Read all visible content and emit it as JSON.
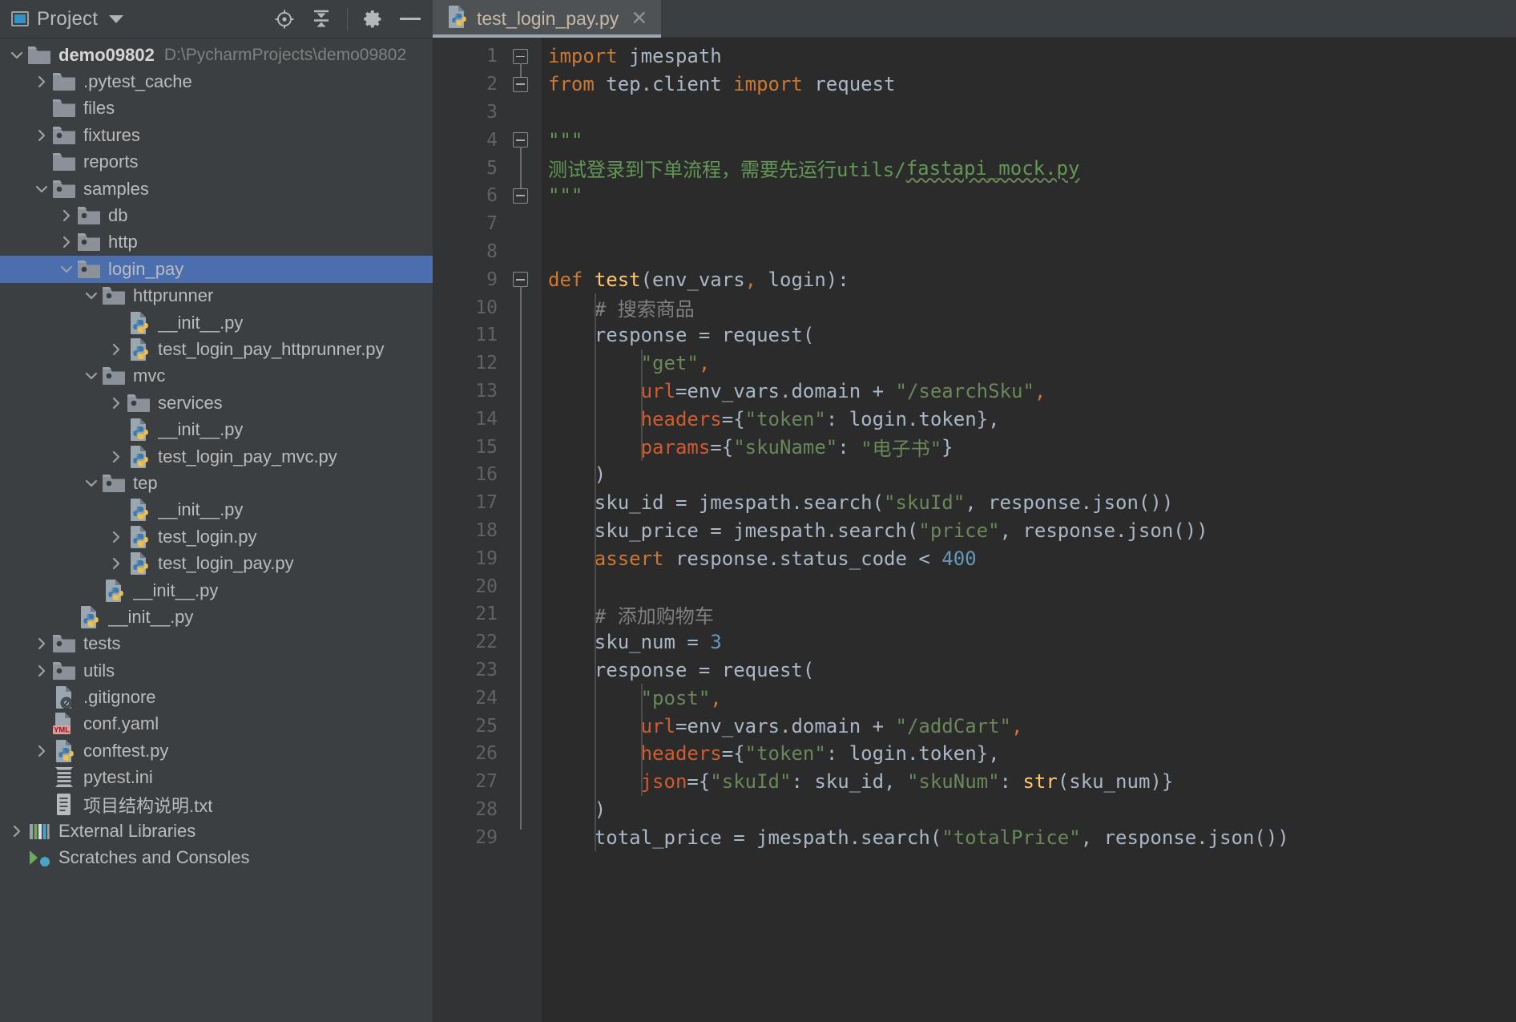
{
  "toolwindow": {
    "title": "Project",
    "dropdown_icon": "chevron-down-icon",
    "window_icon": "project-window-icon",
    "actions": [
      {
        "name": "locate-icon",
        "title": "Select Opened File"
      },
      {
        "name": "collapse-all-icon",
        "title": "Collapse All"
      },
      {
        "name": "gear-icon",
        "title": "Settings"
      },
      {
        "name": "minimize-icon",
        "title": "Hide"
      }
    ]
  },
  "tree": [
    {
      "label": "demo09802",
      "path": "D:\\PycharmProjects\\demo09802",
      "icon": "folder-icon",
      "arrow": "down",
      "indent": 0,
      "bold": true,
      "selected": false
    },
    {
      "label": ".pytest_cache",
      "path": "",
      "icon": "folder-icon",
      "arrow": "right",
      "indent": 1,
      "bold": false,
      "selected": false
    },
    {
      "label": "files",
      "path": "",
      "icon": "folder-icon",
      "arrow": "none",
      "indent": 1,
      "bold": false,
      "selected": false
    },
    {
      "label": "fixtures",
      "path": "",
      "icon": "source-folder-icon",
      "arrow": "right",
      "indent": 1,
      "bold": false,
      "selected": false
    },
    {
      "label": "reports",
      "path": "",
      "icon": "folder-icon",
      "arrow": "none",
      "indent": 1,
      "bold": false,
      "selected": false
    },
    {
      "label": "samples",
      "path": "",
      "icon": "source-folder-icon",
      "arrow": "down",
      "indent": 1,
      "bold": false,
      "selected": false
    },
    {
      "label": "db",
      "path": "",
      "icon": "source-folder-icon",
      "arrow": "right",
      "indent": 2,
      "bold": false,
      "selected": false
    },
    {
      "label": "http",
      "path": "",
      "icon": "source-folder-icon",
      "arrow": "right",
      "indent": 2,
      "bold": false,
      "selected": false
    },
    {
      "label": "login_pay",
      "path": "",
      "icon": "source-folder-icon",
      "arrow": "down",
      "indent": 2,
      "bold": false,
      "selected": true
    },
    {
      "label": "httprunner",
      "path": "",
      "icon": "source-folder-icon",
      "arrow": "down",
      "indent": 3,
      "bold": false,
      "selected": false
    },
    {
      "label": "__init__.py",
      "path": "",
      "icon": "python-file-icon",
      "arrow": "none",
      "indent": 4,
      "bold": false,
      "selected": false
    },
    {
      "label": "test_login_pay_httprunner.py",
      "path": "",
      "icon": "python-file-icon",
      "arrow": "right",
      "indent": 4,
      "bold": false,
      "selected": false
    },
    {
      "label": "mvc",
      "path": "",
      "icon": "source-folder-icon",
      "arrow": "down",
      "indent": 3,
      "bold": false,
      "selected": false
    },
    {
      "label": "services",
      "path": "",
      "icon": "source-folder-icon",
      "arrow": "right",
      "indent": 4,
      "bold": false,
      "selected": false
    },
    {
      "label": "__init__.py",
      "path": "",
      "icon": "python-file-icon",
      "arrow": "none",
      "indent": 4,
      "bold": false,
      "selected": false
    },
    {
      "label": "test_login_pay_mvc.py",
      "path": "",
      "icon": "python-file-icon",
      "arrow": "right",
      "indent": 4,
      "bold": false,
      "selected": false
    },
    {
      "label": "tep",
      "path": "",
      "icon": "source-folder-icon",
      "arrow": "down",
      "indent": 3,
      "bold": false,
      "selected": false
    },
    {
      "label": "__init__.py",
      "path": "",
      "icon": "python-file-icon",
      "arrow": "none",
      "indent": 4,
      "bold": false,
      "selected": false
    },
    {
      "label": "test_login.py",
      "path": "",
      "icon": "python-file-icon",
      "arrow": "right",
      "indent": 4,
      "bold": false,
      "selected": false
    },
    {
      "label": "test_login_pay.py",
      "path": "",
      "icon": "python-file-icon",
      "arrow": "right",
      "indent": 4,
      "bold": false,
      "selected": false
    },
    {
      "label": "__init__.py",
      "path": "",
      "icon": "python-file-icon",
      "arrow": "none",
      "indent": 3,
      "bold": false,
      "selected": false
    },
    {
      "label": "__init__.py",
      "path": "",
      "icon": "python-file-icon",
      "arrow": "none",
      "indent": 2,
      "bold": false,
      "selected": false
    },
    {
      "label": "tests",
      "path": "",
      "icon": "source-folder-icon",
      "arrow": "right",
      "indent": 1,
      "bold": false,
      "selected": false
    },
    {
      "label": "utils",
      "path": "",
      "icon": "source-folder-icon",
      "arrow": "right",
      "indent": 1,
      "bold": false,
      "selected": false
    },
    {
      "label": ".gitignore",
      "path": "",
      "icon": "gitignore-file-icon",
      "arrow": "none",
      "indent": 1,
      "bold": false,
      "selected": false
    },
    {
      "label": "conf.yaml",
      "path": "",
      "icon": "yaml-file-icon",
      "arrow": "none",
      "indent": 1,
      "bold": false,
      "selected": false
    },
    {
      "label": "conftest.py",
      "path": "",
      "icon": "python-file-icon",
      "arrow": "right",
      "indent": 1,
      "bold": false,
      "selected": false
    },
    {
      "label": "pytest.ini",
      "path": "",
      "icon": "ini-file-icon",
      "arrow": "none",
      "indent": 1,
      "bold": false,
      "selected": false
    },
    {
      "label": "项目结构说明.txt",
      "path": "",
      "icon": "text-file-icon",
      "arrow": "none",
      "indent": 1,
      "bold": false,
      "selected": false
    },
    {
      "label": "External Libraries",
      "path": "",
      "icon": "libraries-icon",
      "arrow": "right",
      "indent": 0,
      "bold": false,
      "selected": false
    },
    {
      "label": "Scratches and Consoles",
      "path": "",
      "icon": "scratches-icon",
      "arrow": "none",
      "indent": 0,
      "bold": false,
      "selected": false
    }
  ],
  "editor": {
    "tab": {
      "name": "test_login_pay.py",
      "icon": "python-file-icon",
      "close_icon": "close-icon"
    },
    "first_line": 1,
    "lines": [
      {
        "n": 1,
        "fold": "start",
        "run": false,
        "tokens": [
          {
            "t": "import",
            "c": "kw"
          },
          {
            "t": " jmespath",
            "c": "pln"
          }
        ]
      },
      {
        "n": 2,
        "fold": "end",
        "run": false,
        "tokens": [
          {
            "t": "from",
            "c": "kw"
          },
          {
            "t": " tep.client ",
            "c": "pln"
          },
          {
            "t": "import",
            "c": "kw"
          },
          {
            "t": " request",
            "c": "pln"
          }
        ]
      },
      {
        "n": 3,
        "fold": "none",
        "run": false,
        "tokens": []
      },
      {
        "n": 4,
        "fold": "start",
        "run": false,
        "tokens": [
          {
            "t": "\"\"\"",
            "c": "doc"
          }
        ]
      },
      {
        "n": 5,
        "fold": "none",
        "run": false,
        "tokens": [
          {
            "t": "测试登录到下单流程，需要先运行utils/",
            "c": "doc"
          },
          {
            "t": "fastapi_mock.py",
            "c": "doc sq"
          }
        ]
      },
      {
        "n": 6,
        "fold": "end",
        "run": false,
        "tokens": [
          {
            "t": "\"\"\"",
            "c": "doc"
          }
        ]
      },
      {
        "n": 7,
        "fold": "none",
        "run": false,
        "tokens": []
      },
      {
        "n": 8,
        "fold": "none",
        "run": false,
        "tokens": []
      },
      {
        "n": 9,
        "fold": "start",
        "run": true,
        "tokens": [
          {
            "t": "def",
            "c": "kw"
          },
          {
            "t": " ",
            "c": "pln"
          },
          {
            "t": "test",
            "c": "fn"
          },
          {
            "t": "(env_vars",
            "c": "pln"
          },
          {
            "t": ",",
            "c": "comma"
          },
          {
            "t": " login):",
            "c": "pln"
          }
        ]
      },
      {
        "n": 10,
        "fold": "none",
        "run": false,
        "tokens": [
          {
            "t": "    # 搜索商品",
            "c": "cmt"
          }
        ]
      },
      {
        "n": 11,
        "fold": "none",
        "run": false,
        "tokens": [
          {
            "t": "    response = request(",
            "c": "pln"
          }
        ]
      },
      {
        "n": 12,
        "fold": "none",
        "run": false,
        "tokens": [
          {
            "t": "        ",
            "c": "pln"
          },
          {
            "t": "\"get\"",
            "c": "str"
          },
          {
            "t": ",",
            "c": "comma"
          }
        ]
      },
      {
        "n": 13,
        "fold": "none",
        "run": false,
        "tokens": [
          {
            "t": "        ",
            "c": "pln"
          },
          {
            "t": "url",
            "c": "kwarg"
          },
          {
            "t": "=env_vars.domain + ",
            "c": "pln"
          },
          {
            "t": "\"/searchSku\"",
            "c": "str"
          },
          {
            "t": ",",
            "c": "comma"
          }
        ]
      },
      {
        "n": 14,
        "fold": "none",
        "run": false,
        "tokens": [
          {
            "t": "        ",
            "c": "pln"
          },
          {
            "t": "headers",
            "c": "kwarg"
          },
          {
            "t": "={",
            "c": "pln"
          },
          {
            "t": "\"token\"",
            "c": "str"
          },
          {
            "t": ": login.token},",
            "c": "pln"
          }
        ]
      },
      {
        "n": 15,
        "fold": "none",
        "run": false,
        "tokens": [
          {
            "t": "        ",
            "c": "pln"
          },
          {
            "t": "params",
            "c": "kwarg"
          },
          {
            "t": "={",
            "c": "pln"
          },
          {
            "t": "\"skuName\"",
            "c": "str"
          },
          {
            "t": ": ",
            "c": "pln"
          },
          {
            "t": "\"电子书\"",
            "c": "str"
          },
          {
            "t": "}",
            "c": "pln"
          }
        ]
      },
      {
        "n": 16,
        "fold": "none",
        "run": false,
        "tokens": [
          {
            "t": "    )",
            "c": "pln"
          }
        ]
      },
      {
        "n": 17,
        "fold": "none",
        "run": false,
        "tokens": [
          {
            "t": "    sku_id = jmespath.search(",
            "c": "pln"
          },
          {
            "t": "\"skuId\"",
            "c": "str"
          },
          {
            "t": ", response.json())",
            "c": "pln"
          }
        ]
      },
      {
        "n": 18,
        "fold": "none",
        "run": false,
        "tokens": [
          {
            "t": "    sku_price = jmespath.search(",
            "c": "pln"
          },
          {
            "t": "\"price\"",
            "c": "str"
          },
          {
            "t": ", response.json())",
            "c": "pln"
          }
        ]
      },
      {
        "n": 19,
        "fold": "none",
        "run": false,
        "tokens": [
          {
            "t": "    ",
            "c": "pln"
          },
          {
            "t": "assert",
            "c": "kw"
          },
          {
            "t": " response.status_code < ",
            "c": "pln"
          },
          {
            "t": "400",
            "c": "num"
          }
        ]
      },
      {
        "n": 20,
        "fold": "none",
        "run": false,
        "tokens": []
      },
      {
        "n": 21,
        "fold": "none",
        "run": false,
        "tokens": [
          {
            "t": "    # 添加购物车",
            "c": "cmt"
          }
        ]
      },
      {
        "n": 22,
        "fold": "none",
        "run": false,
        "tokens": [
          {
            "t": "    sku_num = ",
            "c": "pln"
          },
          {
            "t": "3",
            "c": "num"
          }
        ]
      },
      {
        "n": 23,
        "fold": "none",
        "run": false,
        "tokens": [
          {
            "t": "    response = request(",
            "c": "pln"
          }
        ]
      },
      {
        "n": 24,
        "fold": "none",
        "run": false,
        "tokens": [
          {
            "t": "        ",
            "c": "pln"
          },
          {
            "t": "\"post\"",
            "c": "str"
          },
          {
            "t": ",",
            "c": "comma"
          }
        ]
      },
      {
        "n": 25,
        "fold": "none",
        "run": false,
        "tokens": [
          {
            "t": "        ",
            "c": "pln"
          },
          {
            "t": "url",
            "c": "kwarg"
          },
          {
            "t": "=env_vars.domain + ",
            "c": "pln"
          },
          {
            "t": "\"/addCart\"",
            "c": "str"
          },
          {
            "t": ",",
            "c": "comma"
          }
        ]
      },
      {
        "n": 26,
        "fold": "none",
        "run": false,
        "tokens": [
          {
            "t": "        ",
            "c": "pln"
          },
          {
            "t": "headers",
            "c": "kwarg"
          },
          {
            "t": "={",
            "c": "pln"
          },
          {
            "t": "\"token\"",
            "c": "str"
          },
          {
            "t": ": login.token},",
            "c": "pln"
          }
        ]
      },
      {
        "n": 27,
        "fold": "none",
        "run": false,
        "tokens": [
          {
            "t": "        ",
            "c": "pln"
          },
          {
            "t": "json",
            "c": "kwarg"
          },
          {
            "t": "={",
            "c": "pln"
          },
          {
            "t": "\"skuId\"",
            "c": "str"
          },
          {
            "t": ": sku_id, ",
            "c": "pln"
          },
          {
            "t": "\"skuNum\"",
            "c": "str"
          },
          {
            "t": ": ",
            "c": "pln"
          },
          {
            "t": "str",
            "c": "fn"
          },
          {
            "t": "(sku_num)}",
            "c": "pln"
          }
        ]
      },
      {
        "n": 28,
        "fold": "none",
        "run": false,
        "tokens": [
          {
            "t": "    )",
            "c": "pln"
          }
        ]
      },
      {
        "n": 29,
        "fold": "none",
        "run": false,
        "tokens": [
          {
            "t": "    total_price = jmespath.search(",
            "c": "pln"
          },
          {
            "t": "\"totalPrice\"",
            "c": "str"
          },
          {
            "t": ", response.json())",
            "c": "pln"
          }
        ]
      }
    ]
  }
}
